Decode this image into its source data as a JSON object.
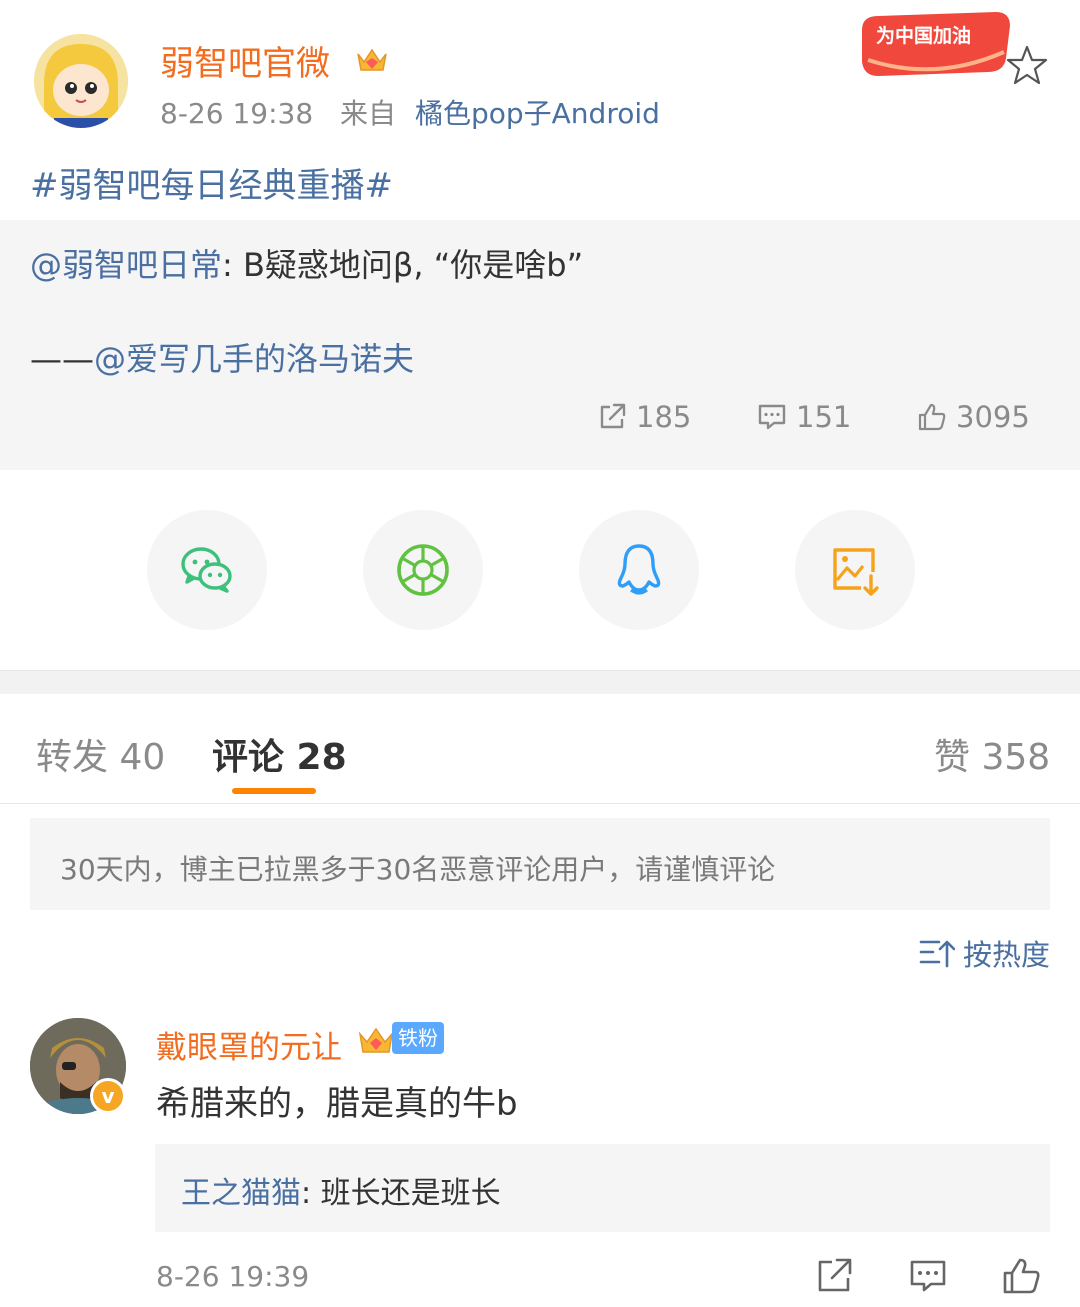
{
  "post": {
    "author": "弱智吧官微",
    "timestamp": "8-26 19:38",
    "source_prefix": "来自",
    "source": "橘色pop子Android",
    "badge_text": "为中国加油",
    "topic": "#弱智吧每日经典重播#"
  },
  "repost": {
    "mention1": "@弱智吧日常",
    "text1": ": B疑惑地问β, “你是啥b”",
    "dash": "——",
    "mention2": "@爱写几手的洛马诺夫",
    "stats": {
      "reposts": "185",
      "comments": "151",
      "likes": "3095"
    }
  },
  "share": [
    {
      "name": "wechat-icon"
    },
    {
      "name": "moments-icon"
    },
    {
      "name": "qq-icon"
    },
    {
      "name": "save-image-icon"
    }
  ],
  "tabs": {
    "repost_label": "转发 40",
    "comment_label": "评论 28",
    "like_label": "赞 358"
  },
  "notice": "30天内，博主已拉黑多于30名恶意评论用户，请谨慎评论",
  "sort_label": "按热度",
  "comment": {
    "author": "戴眼罩的元让",
    "fan_badge": "铁粉",
    "text": "希腊来的，腊是真的牛b",
    "reply_author": "王之猫猫",
    "reply_text": ": 班长还是班长",
    "timestamp": "8-26 19:39"
  },
  "colors": {
    "accent_orange": "#ff8200",
    "username_orange": "#f26d1f",
    "link_blue": "#4a6fa1"
  }
}
